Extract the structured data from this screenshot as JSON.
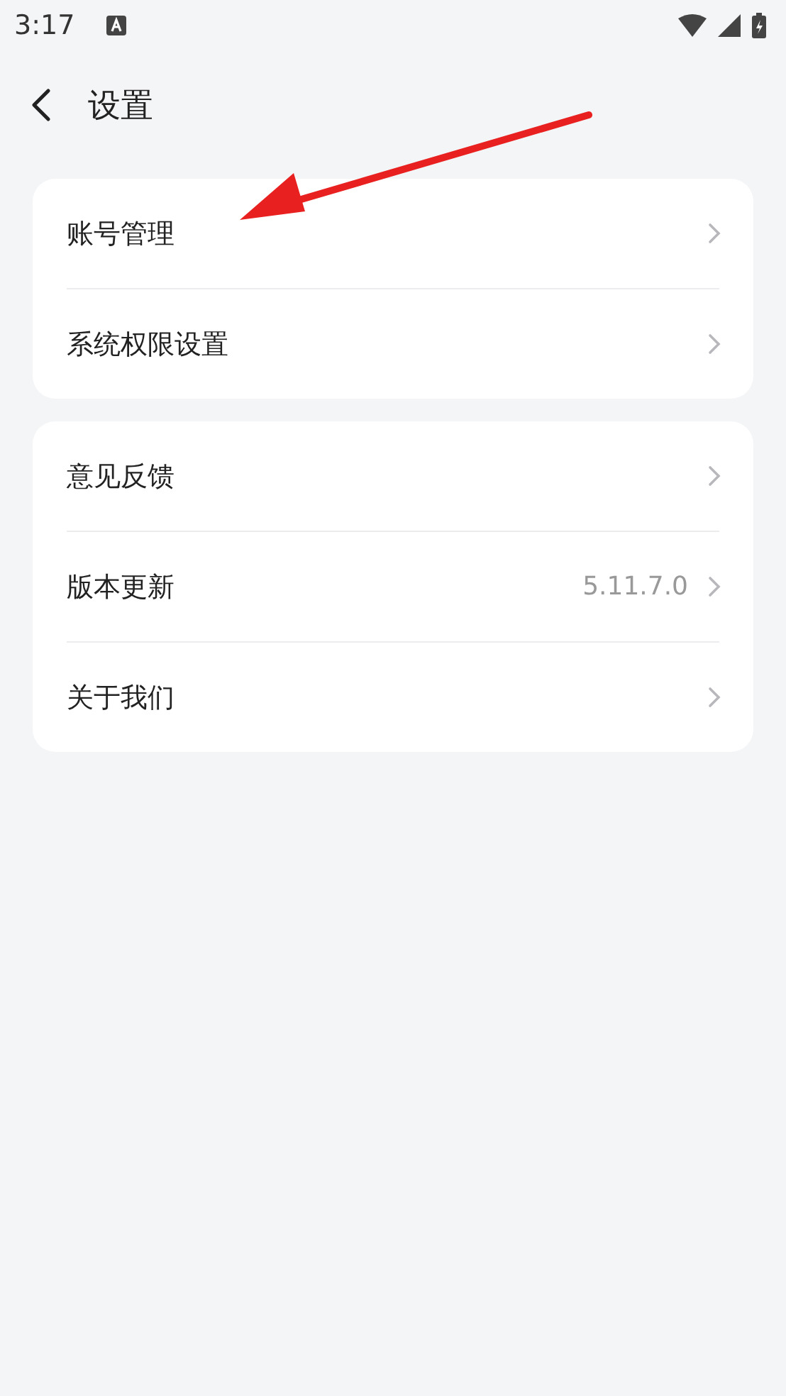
{
  "status_bar": {
    "time": "3:17"
  },
  "header": {
    "title": "设置"
  },
  "groups": [
    {
      "items": [
        {
          "label": "账号管理"
        },
        {
          "label": "系统权限设置"
        }
      ]
    },
    {
      "items": [
        {
          "label": "意见反馈"
        },
        {
          "label": "版本更新",
          "value": "5.11.7.0"
        },
        {
          "label": "关于我们"
        }
      ]
    }
  ]
}
